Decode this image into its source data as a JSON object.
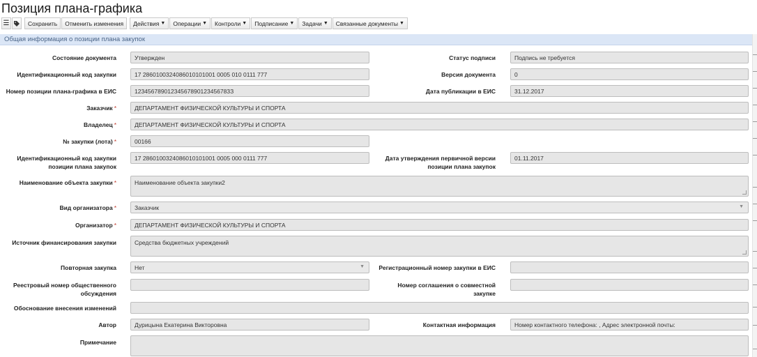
{
  "page": {
    "title": "Позиция плана-графика"
  },
  "toolbar": {
    "menu_icon": "hamburger-icon",
    "tag_icon": "tag-icon",
    "save": "Сохранить",
    "cancel": "Отменить изменения",
    "actions": "Действия",
    "operations": "Операции",
    "controls": "Контроли",
    "signing": "Подписание",
    "tasks": "Задачи",
    "related": "Связанные документы"
  },
  "section": {
    "title": "Общая информация о позиции плана закупок"
  },
  "form": {
    "doc_status": {
      "label": "Состояние документа",
      "value": "Утвержден"
    },
    "sign_status": {
      "label": "Статус подписи",
      "value": "Подпись не требуется"
    },
    "ikz": {
      "label": "Идентификационный код закупки",
      "value": "17 2860100324086010101001 0005 010 0111 777"
    },
    "doc_version": {
      "label": "Версия документа",
      "value": "0"
    },
    "eis_position": {
      "label": "Номер позиции плана-графика в ЕИС",
      "value": "12345678901234567890123456783З"
    },
    "eis_pub_date": {
      "label": "Дата публикации в ЕИС",
      "value": "31.12.2017"
    },
    "customer": {
      "label": "Заказчик",
      "value": "ДЕПАРТАМЕНТ ФИЗИЧЕСКОЙ КУЛЬТУРЫ И СПОРТА"
    },
    "owner": {
      "label": "Владелец",
      "value": "ДЕПАРТАМЕНТ ФИЗИЧЕСКОЙ КУЛЬТУРЫ И СПОРТА"
    },
    "lot_number": {
      "label": "№ закупки (лота)",
      "value": "00166"
    },
    "ikz_plan": {
      "label_line1": "Идентификационный код закупки",
      "label_line2": "позиции плана закупок",
      "value": "17 2860100324086010101001 0005 000 0111 777"
    },
    "first_approval": {
      "label_line1": "Дата утверждения первичной версии",
      "label_line2": "позиции плана закупок",
      "value": "01.11.2017"
    },
    "object_name": {
      "label": "Наименование объекта закупки",
      "value": "Наименование объекта закупки2"
    },
    "organizer_type": {
      "label": "Вид организатора",
      "value": "Заказчик"
    },
    "organizer": {
      "label": "Организатор",
      "value": "ДЕПАРТАМЕНТ ФИЗИЧЕСКОЙ КУЛЬТУРЫ И СПОРТА"
    },
    "funding": {
      "label": "Источник финансирования закупки",
      "value": "Средства бюджетных учреждений"
    },
    "repeat": {
      "label": "Повторная закупка",
      "value": "Нет"
    },
    "eis_reg_number": {
      "label": "Регистрационный номер закупки в ЕИС",
      "value": ""
    },
    "public_discussion": {
      "label_line1": "Реестровый номер общественного",
      "label_line2": "обсуждения",
      "value": ""
    },
    "joint_agreement": {
      "label_line1": "Номер соглашения о совместной",
      "label_line2": "закупке",
      "value": ""
    },
    "change_reason": {
      "label": "Обоснование внесения изменений",
      "value": ""
    },
    "author": {
      "label": "Автор",
      "value": "Дурицына Екатерина Викторовна"
    },
    "contact": {
      "label": "Контактная информация",
      "value": "Номер контактного телефона: , Адрес электронной почты:"
    },
    "note": {
      "label": "Примечание",
      "value": ""
    },
    "required_mark": "*"
  }
}
